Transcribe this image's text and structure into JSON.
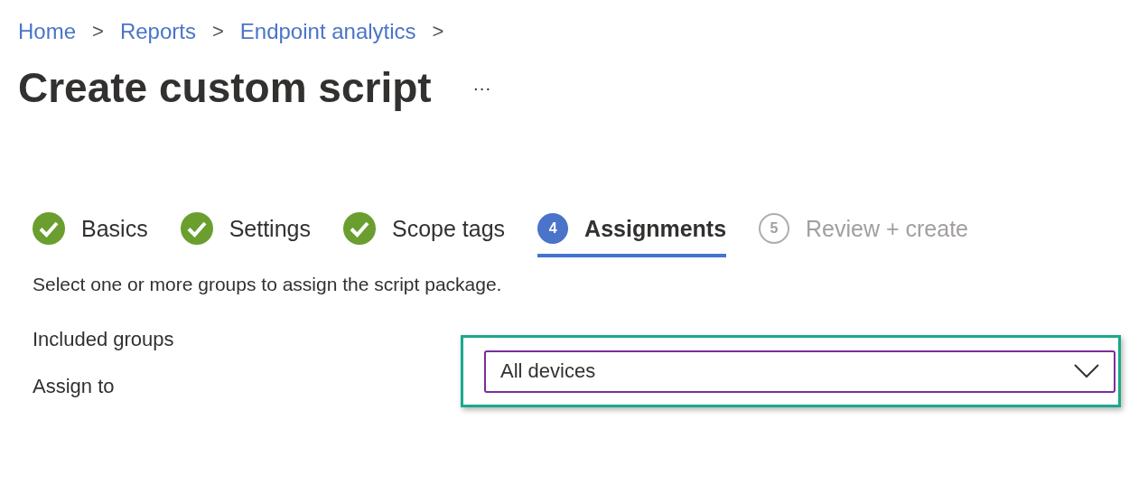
{
  "breadcrumb": [
    {
      "label": "Home"
    },
    {
      "label": "Reports"
    },
    {
      "label": "Endpoint analytics"
    }
  ],
  "breadcrumb_separator": ">",
  "title": "Create custom script",
  "more_button": "···",
  "steps": [
    {
      "kind": "done",
      "label": "Basics",
      "selected": false
    },
    {
      "kind": "done",
      "label": "Settings",
      "selected": false
    },
    {
      "kind": "done",
      "label": "Scope tags",
      "selected": false
    },
    {
      "kind": "current",
      "number": "4",
      "label": "Assignments",
      "selected": true
    },
    {
      "kind": "pending",
      "number": "5",
      "label": "Review + create",
      "selected": false
    }
  ],
  "description": "Select one or more groups to assign the script package.",
  "section_label": "Included groups",
  "assign_to": {
    "label": "Assign to",
    "value": "All devices"
  }
}
